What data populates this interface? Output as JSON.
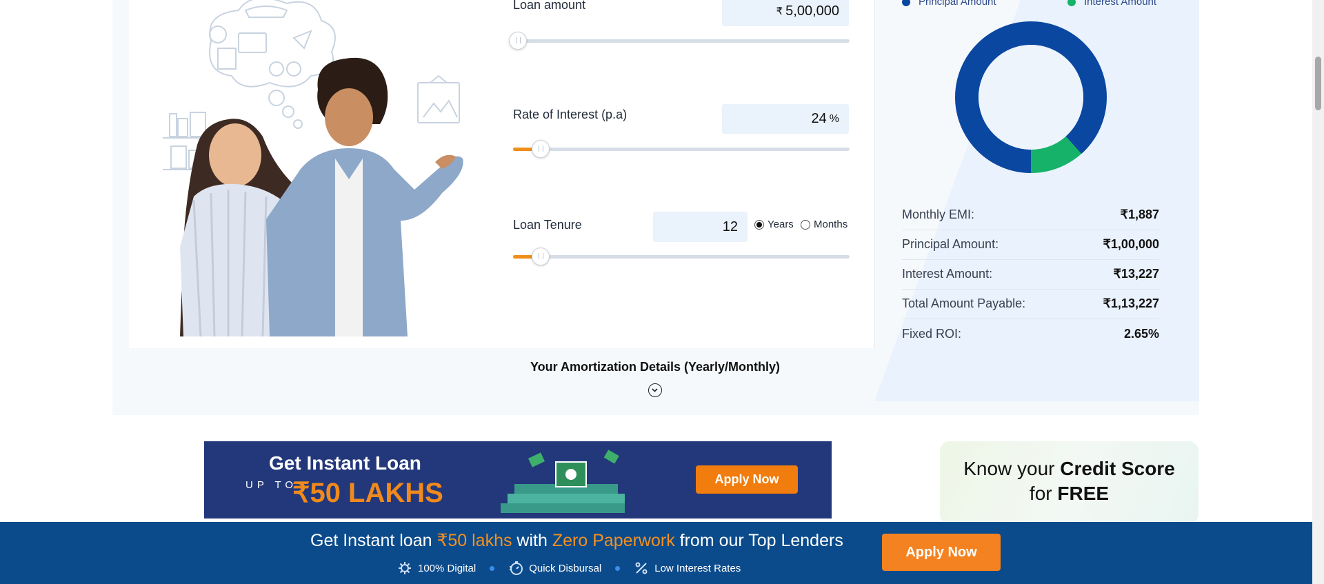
{
  "calculator": {
    "loan_amount": {
      "label": "Loan amount",
      "currency": "₹",
      "value": "5,00,000",
      "slider_fraction": 0.0
    },
    "rate": {
      "label": "Rate of Interest (p.a)",
      "value": "24",
      "unit": "%",
      "slider_fraction": 0.08
    },
    "tenure": {
      "label": "Loan Tenure",
      "value": "12",
      "unit_options": [
        "Years",
        "Months"
      ],
      "selected_unit": "Years",
      "slider_fraction": 0.08
    }
  },
  "summary": {
    "legend": [
      {
        "label": "Principal Amount",
        "color": "#0a47a1"
      },
      {
        "label": "Interest Amount",
        "color": "#17b26a"
      }
    ],
    "donut": {
      "principal_fraction": 0.884,
      "interest_fraction": 0.116
    },
    "rows": [
      {
        "label": "Monthly EMI:",
        "value": "₹1,887"
      },
      {
        "label": "Principal Amount:",
        "value": "₹1,00,000"
      },
      {
        "label": "Interest Amount:",
        "value": "₹13,227"
      },
      {
        "label": "Total Amount Payable:",
        "value": "₹1,13,227"
      },
      {
        "label": "Fixed ROI:",
        "value": "2.65%"
      }
    ]
  },
  "amortization": {
    "title": "Your Amortization Details (Yearly/Monthly)"
  },
  "banner": {
    "title": "Get Instant Loan",
    "upto": "UP TO",
    "amount": "₹50 LAKHS",
    "button": "Apply Now"
  },
  "credit": {
    "line1_prefix": "Know your ",
    "line1_bold": "Credit Score",
    "line2_prefix": "for ",
    "line2_bold": "FREE"
  },
  "footer": {
    "headline_parts": [
      "Get Instant loan ",
      "₹50 lakhs",
      " with ",
      "Zero Paperwork",
      " from our Top Lenders"
    ],
    "features": [
      "100% Digital",
      "Quick Disbursal",
      "Low Interest Rates"
    ],
    "apply": "Apply Now"
  }
}
